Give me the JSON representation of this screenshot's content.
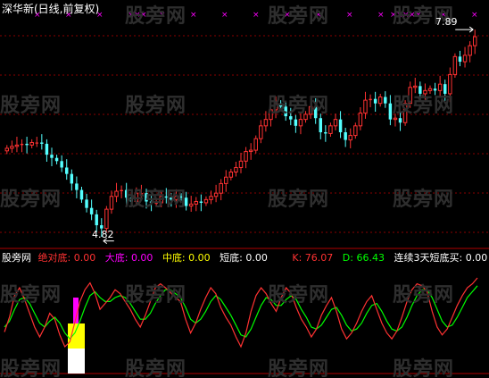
{
  "window": {
    "title": "深华新(日线,前复权)",
    "watermark": "股旁网"
  },
  "price_panel": {
    "high_label": "7.89",
    "low_label": "4.82",
    "colors": {
      "up": "#ff3232",
      "down": "#54ffff",
      "grid": "#8a0000",
      "signal": "#ff00ff"
    }
  },
  "indicator_panel": {
    "name": "股旁网",
    "items": [
      {
        "label": "绝对底:",
        "value": "0.00",
        "color": "#ff3232"
      },
      {
        "label": "大底:",
        "value": "0.00",
        "color": "#ff00ff"
      },
      {
        "label": "中底:",
        "value": "0.00",
        "color": "#ffff00"
      },
      {
        "label": "短底:",
        "value": "0.00",
        "color": "#ffffff"
      },
      {
        "label": "K:",
        "value": "76.07",
        "color": "#ff3232"
      },
      {
        "label": "D:",
        "value": "66.43",
        "color": "#00ff00"
      },
      {
        "label": "连续3天短底买:",
        "value": "0.00",
        "color": "#ffffff"
      }
    ],
    "colors": {
      "k": "#ff3232",
      "d": "#00ff00",
      "bar_white": "#ffffff",
      "bar_yellow": "#ffff00",
      "bar_magenta": "#ff00ff"
    }
  },
  "chart_data": [
    {
      "type": "candlestick",
      "title": "深华新(日线,前复权)",
      "annotations": [
        {
          "text": "7.89",
          "value": 7.89,
          "kind": "high"
        },
        {
          "text": "4.82",
          "value": 4.82,
          "kind": "low"
        }
      ],
      "close": [
        6.15,
        6.18,
        6.2,
        6.22,
        6.2,
        6.24,
        6.24,
        6.22,
        6.05,
        6.0,
        5.95,
        5.85,
        5.75,
        5.6,
        5.5,
        5.35,
        5.22,
        5.12,
        4.95,
        4.9,
        5.2,
        5.4,
        5.48,
        5.5,
        5.38,
        5.32,
        5.45,
        5.45,
        5.32,
        5.3,
        5.3,
        5.4,
        5.38,
        5.35,
        5.4,
        5.38,
        5.25,
        5.28,
        5.32,
        5.3,
        5.35,
        5.4,
        5.45,
        5.6,
        5.7,
        5.78,
        5.85,
        5.95,
        6.1,
        6.12,
        6.3,
        6.5,
        6.6,
        6.75,
        6.85,
        6.8,
        6.65,
        6.6,
        6.5,
        6.6,
        6.68,
        6.8,
        6.62,
        6.4,
        6.38,
        6.5,
        6.6,
        6.4,
        6.28,
        6.35,
        6.5,
        6.7,
        6.9,
        6.92,
        6.85,
        6.95,
        6.85,
        6.6,
        6.62,
        6.55,
        6.85,
        7.1,
        7.12,
        7.0,
        7.05,
        7.08,
        7.05,
        7.15,
        7.0,
        7.3,
        7.58,
        7.5,
        7.6,
        7.75,
        7.89
      ],
      "ylim": [
        4.7,
        8.1
      ],
      "grid": true
    },
    {
      "type": "line",
      "series": [
        {
          "name": "K",
          "values": [
            35,
            50,
            72,
            80,
            68,
            54,
            40,
            30,
            40,
            54,
            48,
            32,
            20,
            25,
            45,
            66,
            78,
            85,
            74,
            58,
            64,
            70,
            78,
            74,
            66,
            58,
            48,
            40,
            52,
            66,
            80,
            84,
            80,
            75,
            70,
            66,
            48,
            34,
            44,
            58,
            70,
            80,
            74,
            60,
            50,
            42,
            30,
            20,
            34,
            56,
            72,
            80,
            74,
            64,
            56,
            70,
            80,
            74,
            60,
            48,
            40,
            30,
            38,
            52,
            62,
            70,
            56,
            38,
            28,
            34,
            44,
            56,
            66,
            72,
            58,
            44,
            34,
            28,
            36,
            50,
            66,
            78,
            84,
            82,
            76,
            56,
            40,
            32,
            38,
            50,
            62,
            72,
            80,
            84,
            90
          ]
        },
        {
          "name": "D",
          "values": [
            40,
            46,
            58,
            68,
            70,
            64,
            54,
            44,
            40,
            46,
            50,
            44,
            34,
            28,
            34,
            46,
            60,
            72,
            76,
            70,
            66,
            66,
            70,
            72,
            70,
            64,
            56,
            48,
            48,
            54,
            64,
            72,
            78,
            78,
            74,
            70,
            60,
            48,
            44,
            48,
            56,
            66,
            72,
            68,
            60,
            52,
            42,
            32,
            30,
            38,
            50,
            62,
            70,
            68,
            62,
            62,
            68,
            72,
            68,
            58,
            50,
            40,
            38,
            42,
            50,
            58,
            60,
            52,
            42,
            36,
            38,
            44,
            54,
            62,
            64,
            56,
            46,
            38,
            36,
            40,
            50,
            62,
            72,
            78,
            78,
            70,
            58,
            46,
            40,
            42,
            50,
            60,
            70,
            76,
            82
          ]
        }
      ],
      "ylim": [
        0,
        100
      ],
      "grid": false
    }
  ]
}
